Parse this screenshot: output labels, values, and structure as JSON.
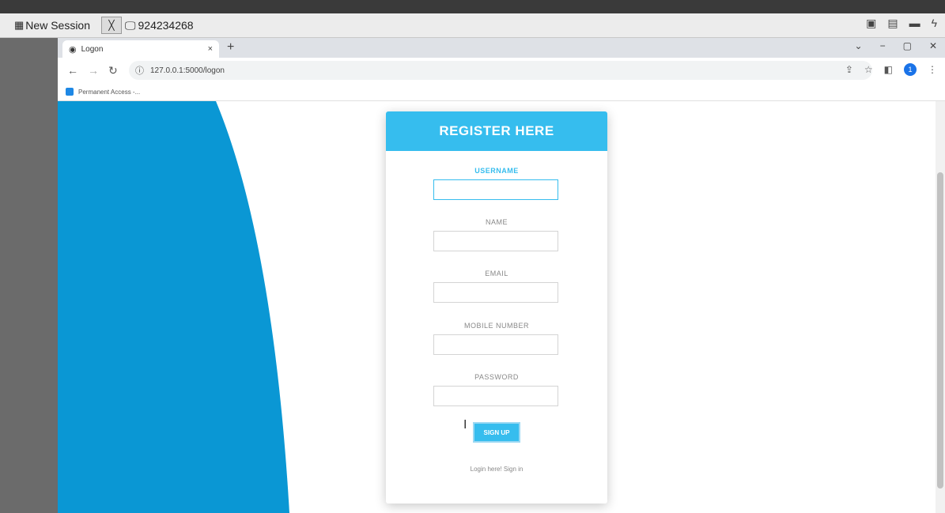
{
  "remote_bar": {
    "new_session": "New Session",
    "close_symbol": "╳",
    "session_id": "924234268"
  },
  "browser": {
    "tab_title": "Logon",
    "tab_close": "×",
    "new_tab": "+",
    "win_minimize": "−",
    "win_restore": "▢",
    "win_close": "✕",
    "url": "127.0.0.1:5000/logon",
    "bookmark": "Permanent Access -...",
    "profile_initial": "1"
  },
  "form": {
    "title": "REGISTER HERE",
    "fields": [
      {
        "label": "USERNAME"
      },
      {
        "label": "NAME"
      },
      {
        "label": "EMAIL"
      },
      {
        "label": "MOBILE NUMBER"
      },
      {
        "label": "PASSWORD"
      }
    ],
    "submit": "SIGN UP",
    "login_text": "Login here! Sign in"
  },
  "colors": {
    "accent": "#36bdee",
    "background_curve": "#0a97d4"
  },
  "icons": {
    "favicon": "globe-icon",
    "back": "arrow-left-icon",
    "forward": "arrow-right-icon",
    "reload": "reload-icon",
    "info": "info-icon",
    "share": "share-icon",
    "star": "star-icon",
    "sidepanel": "side-panel-icon",
    "menu": "kebab-menu-icon"
  }
}
